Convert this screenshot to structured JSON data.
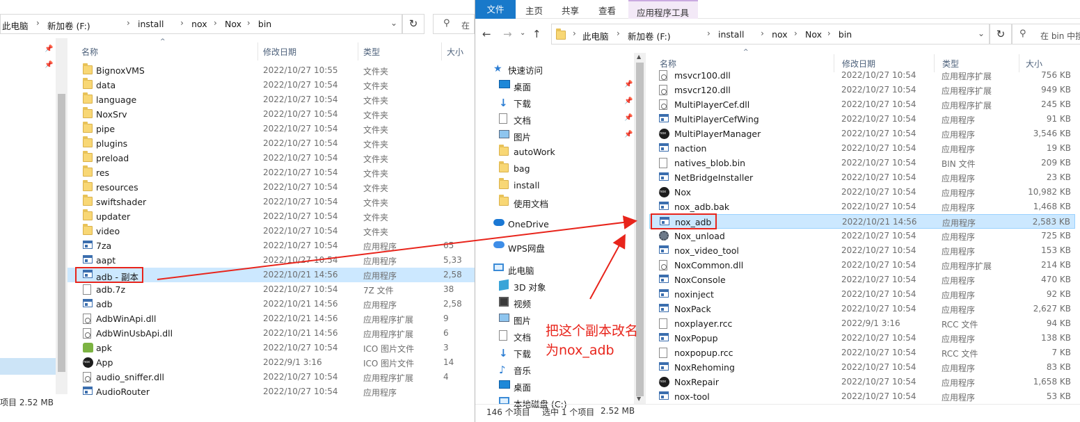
{
  "left": {
    "breadcrumb": [
      "此电脑",
      "新加卷 (F:)",
      "install",
      "nox",
      "Nox",
      "bin"
    ],
    "search_placeholder": "在",
    "headers": {
      "name": "名称",
      "date": "修改日期",
      "type": "类型",
      "size": "大小"
    },
    "rows": [
      {
        "icon": "folder",
        "name": "BignoxVMS",
        "date": "2022/10/27 10:55",
        "type": "文件夹",
        "size": ""
      },
      {
        "icon": "folder",
        "name": "data",
        "date": "2022/10/27 10:54",
        "type": "文件夹",
        "size": ""
      },
      {
        "icon": "folder",
        "name": "language",
        "date": "2022/10/27 10:54",
        "type": "文件夹",
        "size": ""
      },
      {
        "icon": "folder",
        "name": "NoxSrv",
        "date": "2022/10/27 10:54",
        "type": "文件夹",
        "size": ""
      },
      {
        "icon": "folder",
        "name": "pipe",
        "date": "2022/10/27 10:54",
        "type": "文件夹",
        "size": ""
      },
      {
        "icon": "folder",
        "name": "plugins",
        "date": "2022/10/27 10:54",
        "type": "文件夹",
        "size": ""
      },
      {
        "icon": "folder",
        "name": "preload",
        "date": "2022/10/27 10:54",
        "type": "文件夹",
        "size": ""
      },
      {
        "icon": "folder",
        "name": "res",
        "date": "2022/10/27 10:54",
        "type": "文件夹",
        "size": ""
      },
      {
        "icon": "folder",
        "name": "resources",
        "date": "2022/10/27 10:54",
        "type": "文件夹",
        "size": ""
      },
      {
        "icon": "folder",
        "name": "swiftshader",
        "date": "2022/10/27 10:54",
        "type": "文件夹",
        "size": ""
      },
      {
        "icon": "folder",
        "name": "updater",
        "date": "2022/10/27 10:54",
        "type": "文件夹",
        "size": ""
      },
      {
        "icon": "folder",
        "name": "video",
        "date": "2022/10/27 10:54",
        "type": "文件夹",
        "size": ""
      },
      {
        "icon": "exe",
        "name": "7za",
        "date": "2022/10/27 10:54",
        "type": "应用程序",
        "size": "65"
      },
      {
        "icon": "exe",
        "name": "aapt",
        "date": "2022/10/27 10:54",
        "type": "应用程序",
        "size": "5,33"
      },
      {
        "icon": "exe",
        "name": "adb - 副本",
        "date": "2022/10/21 14:56",
        "type": "应用程序",
        "size": "2,58",
        "selected": true
      },
      {
        "icon": "file",
        "name": "adb.7z",
        "date": "2022/10/27 10:54",
        "type": "7Z 文件",
        "size": "38"
      },
      {
        "icon": "exe",
        "name": "adb",
        "date": "2022/10/21 14:56",
        "type": "应用程序",
        "size": "2,58"
      },
      {
        "icon": "dll",
        "name": "AdbWinApi.dll",
        "date": "2022/10/21 14:56",
        "type": "应用程序扩展",
        "size": "9"
      },
      {
        "icon": "dll",
        "name": "AdbWinUsbApi.dll",
        "date": "2022/10/21 14:56",
        "type": "应用程序扩展",
        "size": "6"
      },
      {
        "icon": "apk",
        "name": "apk",
        "date": "2022/10/27 10:54",
        "type": "ICO 图片文件",
        "size": "3"
      },
      {
        "icon": "nox",
        "name": "App",
        "date": "2022/9/1 3:16",
        "type": "ICO 图片文件",
        "size": "14"
      },
      {
        "icon": "dll",
        "name": "audio_sniffer.dll",
        "date": "2022/10/27 10:54",
        "type": "应用程序扩展",
        "size": "4"
      },
      {
        "icon": "exe",
        "name": "AudioRouter",
        "date": "2022/10/27 10:54",
        "type": "应用程序",
        "size": ""
      }
    ],
    "status": "项目  2.52 MB"
  },
  "right": {
    "ribbon_tabs": [
      "文件",
      "主页",
      "共享",
      "查看",
      "应用程序工具"
    ],
    "breadcrumb": [
      "此电脑",
      "新加卷 (F:)",
      "install",
      "nox",
      "Nox",
      "bin"
    ],
    "search_placeholder": "在 bin 中搜",
    "nav": [
      {
        "icon": "star",
        "label": "快速访问",
        "indent": 0,
        "pin": false
      },
      {
        "icon": "desk",
        "label": "桌面",
        "indent": 1,
        "pin": true
      },
      {
        "icon": "down",
        "label": "下载",
        "indent": 1,
        "pin": true
      },
      {
        "icon": "doc",
        "label": "文档",
        "indent": 1,
        "pin": true
      },
      {
        "icon": "pic",
        "label": "图片",
        "indent": 1,
        "pin": true
      },
      {
        "icon": "folder",
        "label": "autoWork",
        "indent": 1,
        "pin": false
      },
      {
        "icon": "folder",
        "label": "bag",
        "indent": 1,
        "pin": false
      },
      {
        "icon": "folder",
        "label": "install",
        "indent": 1,
        "pin": false
      },
      {
        "icon": "folder",
        "label": "使用文档",
        "indent": 1,
        "pin": false
      },
      {
        "icon": "gap",
        "label": "",
        "indent": 0,
        "pin": false
      },
      {
        "icon": "cloud",
        "label": "OneDrive",
        "indent": 0,
        "pin": false
      },
      {
        "icon": "gap",
        "label": "",
        "indent": 0,
        "pin": false
      },
      {
        "icon": "wps",
        "label": "WPS网盘",
        "indent": 0,
        "pin": false
      },
      {
        "icon": "gap",
        "label": "",
        "indent": 0,
        "pin": false
      },
      {
        "icon": "pc",
        "label": "此电脑",
        "indent": 0,
        "pin": false
      },
      {
        "icon": "3d",
        "label": "3D 对象",
        "indent": 1,
        "pin": false
      },
      {
        "icon": "video",
        "label": "视频",
        "indent": 1,
        "pin": false
      },
      {
        "icon": "pic",
        "label": "图片",
        "indent": 1,
        "pin": false
      },
      {
        "icon": "doc",
        "label": "文档",
        "indent": 1,
        "pin": false
      },
      {
        "icon": "down",
        "label": "下载",
        "indent": 1,
        "pin": false
      },
      {
        "icon": "music",
        "label": "音乐",
        "indent": 1,
        "pin": false
      },
      {
        "icon": "desk",
        "label": "桌面",
        "indent": 1,
        "pin": false
      },
      {
        "icon": "pc",
        "label": "本地磁盘 (C:)",
        "indent": 1,
        "pin": false
      }
    ],
    "headers": {
      "name": "名称",
      "date": "修改日期",
      "type": "类型",
      "size": "大小"
    },
    "rows": [
      {
        "icon": "dll",
        "name": "msvcr100.dll",
        "date": "2022/10/27 10:54",
        "type": "应用程序扩展",
        "size": "756 KB"
      },
      {
        "icon": "dll",
        "name": "msvcr120.dll",
        "date": "2022/10/27 10:54",
        "type": "应用程序扩展",
        "size": "949 KB"
      },
      {
        "icon": "dll",
        "name": "MultiPlayerCef.dll",
        "date": "2022/10/27 10:54",
        "type": "应用程序扩展",
        "size": "245 KB"
      },
      {
        "icon": "exe",
        "name": "MultiPlayerCefWing",
        "date": "2022/10/27 10:54",
        "type": "应用程序",
        "size": "91 KB"
      },
      {
        "icon": "nox",
        "name": "MultiPlayerManager",
        "date": "2022/10/27 10:54",
        "type": "应用程序",
        "size": "3,546 KB"
      },
      {
        "icon": "exe",
        "name": "naction",
        "date": "2022/10/27 10:54",
        "type": "应用程序",
        "size": "19 KB"
      },
      {
        "icon": "file",
        "name": "natives_blob.bin",
        "date": "2022/10/27 10:54",
        "type": "BIN 文件",
        "size": "209 KB"
      },
      {
        "icon": "exe",
        "name": "NetBridgeInstaller",
        "date": "2022/10/27 10:54",
        "type": "应用程序",
        "size": "23 KB"
      },
      {
        "icon": "nox",
        "name": "Nox",
        "date": "2022/10/27 10:54",
        "type": "应用程序",
        "size": "10,982 KB"
      },
      {
        "icon": "exe",
        "name": "nox_adb.bak",
        "date": "2022/10/27 10:54",
        "type": "应用程序",
        "size": "1,468 KB"
      },
      {
        "icon": "exe",
        "name": "nox_adb",
        "date": "2022/10/21 14:56",
        "type": "应用程序",
        "size": "2,583 KB",
        "selected": true
      },
      {
        "icon": "gear",
        "name": "Nox_unload",
        "date": "2022/10/27 10:54",
        "type": "应用程序",
        "size": "725 KB"
      },
      {
        "icon": "exe",
        "name": "nox_video_tool",
        "date": "2022/10/27 10:54",
        "type": "应用程序",
        "size": "153 KB"
      },
      {
        "icon": "dll",
        "name": "NoxCommon.dll",
        "date": "2022/10/27 10:54",
        "type": "应用程序扩展",
        "size": "214 KB"
      },
      {
        "icon": "exe",
        "name": "NoxConsole",
        "date": "2022/10/27 10:54",
        "type": "应用程序",
        "size": "470 KB"
      },
      {
        "icon": "exe",
        "name": "noxinject",
        "date": "2022/10/27 10:54",
        "type": "应用程序",
        "size": "92 KB"
      },
      {
        "icon": "exe",
        "name": "NoxPack",
        "date": "2022/10/27 10:54",
        "type": "应用程序",
        "size": "2,627 KB"
      },
      {
        "icon": "file",
        "name": "noxplayer.rcc",
        "date": "2022/9/1 3:16",
        "type": "RCC 文件",
        "size": "94 KB"
      },
      {
        "icon": "exe",
        "name": "NoxPopup",
        "date": "2022/10/27 10:54",
        "type": "应用程序",
        "size": "138 KB"
      },
      {
        "icon": "file",
        "name": "noxpopup.rcc",
        "date": "2022/10/27 10:54",
        "type": "RCC 文件",
        "size": "7 KB"
      },
      {
        "icon": "exe",
        "name": "NoxRehoming",
        "date": "2022/10/27 10:54",
        "type": "应用程序",
        "size": "83 KB"
      },
      {
        "icon": "nox",
        "name": "NoxRepair",
        "date": "2022/10/27 10:54",
        "type": "应用程序",
        "size": "1,658 KB"
      },
      {
        "icon": "exe",
        "name": "nox-tool",
        "date": "2022/10/27 10:54",
        "type": "应用程序",
        "size": "53 KB"
      }
    ],
    "status": {
      "count": "146 个项目",
      "selected": "选中 1 个项目",
      "size": "2.52 MB"
    }
  },
  "annotation": {
    "line1": "把这个副本改名",
    "line2": "为nox_adb",
    "color": "#e8241b"
  }
}
